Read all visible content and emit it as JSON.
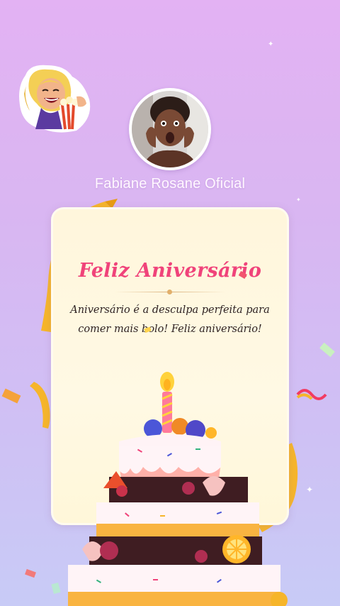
{
  "profile": {
    "name": "Fabiane Rosane Oficial"
  },
  "card": {
    "title": "Feliz Aniversário",
    "message_line_1": "Aniversário é a desculpa perfeita para",
    "message_line_2": "comer mais bolo! Feliz aniversário!"
  },
  "colors": {
    "title": "#f0437a",
    "background_top": "#e3b2f3",
    "background_bottom": "#c8cbf6",
    "card": "#fff8de"
  },
  "icons": {
    "sticker": "woman-popcorn-sticker",
    "cake": "birthday-cake-illustration",
    "sparkle": "sparkle-icon"
  }
}
